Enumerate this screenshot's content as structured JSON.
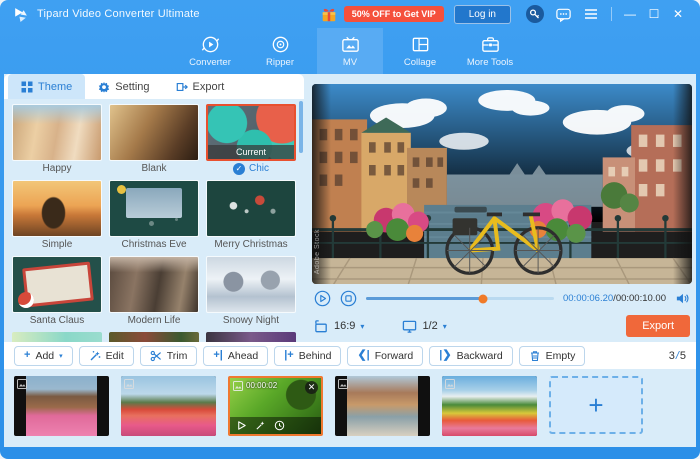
{
  "titlebar": {
    "app_title": "Tipard Video Converter Ultimate",
    "vip_badge": "50% OFF to Get VIP",
    "login_label": "Log in"
  },
  "nav": {
    "tabs": [
      {
        "label": "Converter"
      },
      {
        "label": "Ripper"
      },
      {
        "label": "MV"
      },
      {
        "label": "Collage"
      },
      {
        "label": "More Tools"
      }
    ]
  },
  "left_panel": {
    "tabs": [
      {
        "label": "Theme"
      },
      {
        "label": "Setting"
      },
      {
        "label": "Export"
      }
    ],
    "themes": [
      {
        "name": "Happy"
      },
      {
        "name": "Blank"
      },
      {
        "name": "Chic",
        "current_label": "Current",
        "check": "✓"
      },
      {
        "name": "Simple"
      },
      {
        "name": "Christmas Eve"
      },
      {
        "name": "Merry Christmas"
      },
      {
        "name": "Santa Claus"
      },
      {
        "name": "Modern Life"
      },
      {
        "name": "Snowy Night"
      }
    ]
  },
  "preview": {
    "watermark": "Adobe Stock",
    "current_time": "00:00:06.20",
    "time_sep": "/",
    "total_time": "00:00:10.00",
    "aspect_ratio": "16:9",
    "page": "1/2",
    "caret": "▾",
    "export_label": "Export"
  },
  "toolbar": {
    "add": "Add",
    "edit": "Edit",
    "trim": "Trim",
    "ahead": "Ahead",
    "behind": "Behind",
    "forward": "Forward",
    "backward": "Backward",
    "empty": "Empty",
    "add_plus": "+",
    "ahead_glyph": "+|",
    "behind_glyph": "|+",
    "forward_glyph": "❮|",
    "backward_glyph": "|❯",
    "caret": "▾",
    "counter_current": "3",
    "counter_sep": "/",
    "counter_total": "5"
  },
  "timeline": {
    "selected_clip_time": "00:00:02",
    "close_glyph": "✕",
    "add_plus": "+"
  },
  "window_controls": {
    "minimize": "—",
    "maximize": "☐",
    "close": "✕"
  },
  "colors": {
    "accent_blue": "#2a7fd4",
    "titlebar_blue": "#2e93ea",
    "export_orange": "#f0683a",
    "vip_red": "#f5503c",
    "selected_border": "#e8502f",
    "clip_selected_border": "#f07830"
  }
}
